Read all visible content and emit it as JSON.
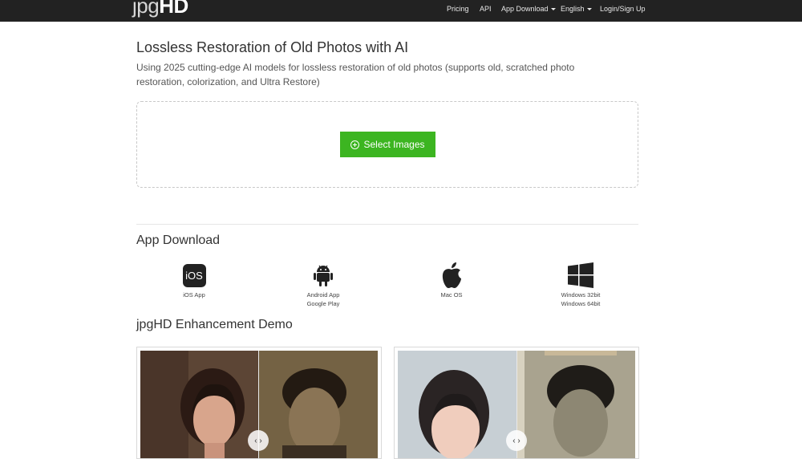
{
  "nav": {
    "logo_thin": "jpg",
    "logo_bold": "HD",
    "pricing": "Pricing",
    "api": "API",
    "app_download": "App Download",
    "language": "English",
    "login": "Login/Sign Up"
  },
  "hero": {
    "title": "Lossless Restoration of Old Photos with AI",
    "subtitle": "Using 2025 cutting-edge AI models for lossless restoration of old photos (supports old, scratched photo restoration, colorization, and Ultra Restore)",
    "select_button": "Select Images"
  },
  "apps": {
    "heading": "App Download",
    "items": [
      {
        "icon": "ios-icon",
        "icon_text": "iOS",
        "line1": "iOS App",
        "line2": ""
      },
      {
        "icon": "android-icon",
        "line1": "Android App",
        "line2": "Google Play"
      },
      {
        "icon": "apple-icon",
        "line1": "Mac OS",
        "line2": ""
      },
      {
        "icon": "windows-icon",
        "line1": "Windows 32bit",
        "line2": "Windows 64bit"
      }
    ]
  },
  "demo": {
    "heading": "jpgHD Enhancement Demo",
    "handle_glyph": "‹ ›"
  },
  "colors": {
    "topbar": "#222222",
    "accent_green": "#3cb521"
  }
}
